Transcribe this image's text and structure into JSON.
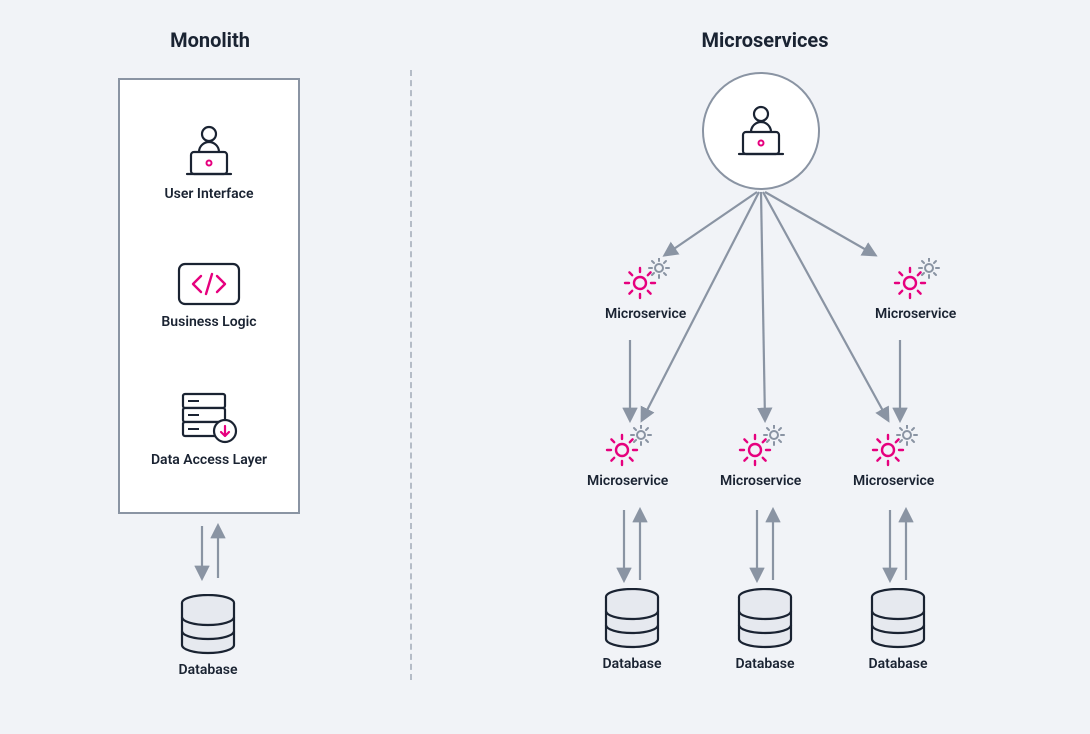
{
  "left": {
    "title": "Monolith",
    "layers": {
      "ui": "User Interface",
      "logic": "Business Logic",
      "data": "Data Access Layer"
    },
    "database": "Database"
  },
  "right": {
    "title": "Microservices",
    "serviceLabel": "Microservice",
    "database": "Database"
  }
}
